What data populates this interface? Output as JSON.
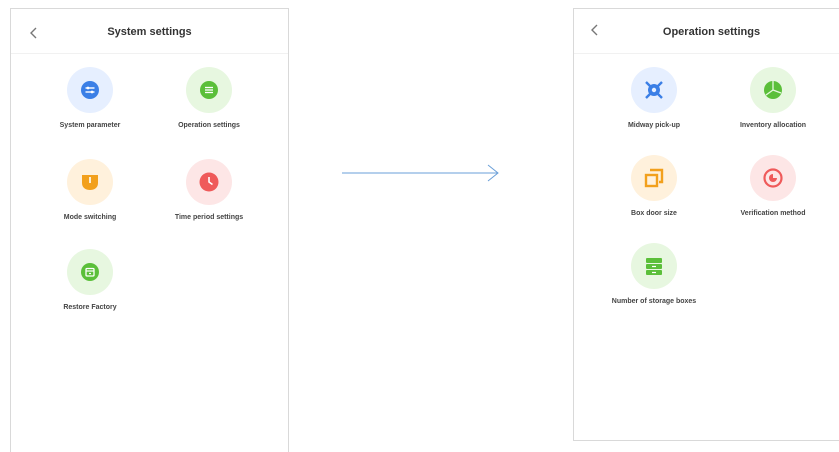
{
  "system_screen": {
    "title": "System settings",
    "items": [
      {
        "label": "System parameter",
        "icon": "system-parameter-icon",
        "color": "#3b7fe6",
        "bg": "#e6efff"
      },
      {
        "label": "Operation settings",
        "icon": "operation-settings-icon",
        "color": "#5bbf3a",
        "bg": "#e7f7e0"
      },
      {
        "label": "Mode switching",
        "icon": "mode-switching-icon",
        "color": "#f2a01c",
        "bg": "#fff1dc"
      },
      {
        "label": "Time period settings",
        "icon": "clock-icon",
        "color": "#ef5a5a",
        "bg": "#fde6e6"
      },
      {
        "label": "Restore Factory",
        "icon": "restore-factory-icon",
        "color": "#5bbf3a",
        "bg": "#e7f7e0"
      }
    ]
  },
  "operation_screen": {
    "title": "Operation settings",
    "items": [
      {
        "label": "Midway pick-up",
        "icon": "midway-pickup-icon",
        "color": "#3b7fe6",
        "bg": "#e6efff"
      },
      {
        "label": "Inventory allocation",
        "icon": "pie-chart-icon",
        "color": "#5bbf3a",
        "bg": "#e7f7e0"
      },
      {
        "label": "Box door size",
        "icon": "box-door-size-icon",
        "color": "#f2a01c",
        "bg": "#fff1dc"
      },
      {
        "label": "Verification method",
        "icon": "verification-method-icon",
        "color": "#ef5a5a",
        "bg": "#fde6e6"
      },
      {
        "label": "Number of storage boxes",
        "icon": "storage-boxes-icon",
        "color": "#5bbf3a",
        "bg": "#e7f7e0"
      }
    ]
  },
  "arrow_color": "#6a9fd8"
}
